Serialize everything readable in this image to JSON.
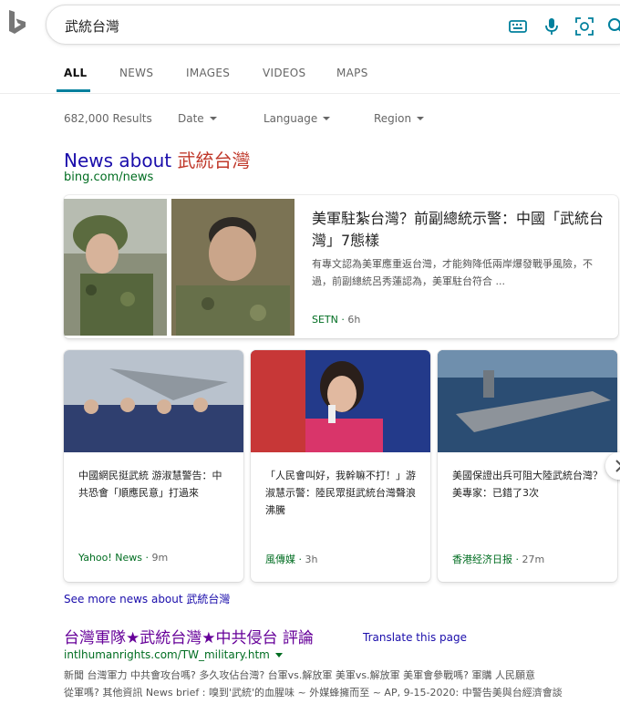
{
  "search": {
    "query": "武統台灣",
    "icons": [
      "keyboard-icon",
      "microphone-icon",
      "visual-search-icon",
      "search-icon"
    ]
  },
  "tabs": [
    "ALL",
    "NEWS",
    "IMAGES",
    "VIDEOS",
    "MAPS"
  ],
  "active_tab": "ALL",
  "filters": {
    "results_count": "682,000 Results",
    "date": "Date",
    "language": "Language",
    "region": "Region"
  },
  "news_section": {
    "title_prefix": "News about ",
    "title_query": "武統台灣",
    "source_url": "bing.com/news",
    "main": {
      "title": "美軍駐紮台灣？前副總統示警：中國「武統台灣」7態樣",
      "snippet": "有專文認為美軍應重返台灣，才能夠降低兩岸爆發戰爭風險，不過，前副總統呂秀蓮認為，美軍駐台符合 ...",
      "source": "SETN",
      "time": "6h"
    },
    "cards": [
      {
        "title": "中國網民挺武統 游淑慧警告：中共恐會「順應民意」打過來",
        "source": "Yahoo! News",
        "time": "9m"
      },
      {
        "title": "「人民會叫好，我幹嘛不打！」游淑慧示警：陸民眾挺武統台灣聲浪沸騰",
        "source": "風傳媒",
        "time": "3h"
      },
      {
        "title": "美國保證出兵可阻大陸武統台灣？美專家：已錯了3次",
        "source": "香港经济日报",
        "time": "27m"
      }
    ],
    "see_more": "See more news about 武統台灣"
  },
  "result": {
    "title": "台灣軍隊★武統台灣★中共侵台 評論",
    "translate": "Translate this page",
    "url": "intlhumanrights.com/TW_military.htm",
    "snippet_line1": "新聞 台灣軍力 中共會攻台嗎? 多久攻佔台灣? 台軍vs.解放軍 美軍vs.解放軍 美軍會參戰嗎? 軍購 人民願意",
    "snippet_line2": "從軍嗎? 其他資訊 News brief : 嗅到'武統'的血腥味 ~ 外媒蜂擁而至 ~ AP, 9-15-2020: 中警告美與台經濟會談"
  },
  "colors": {
    "link": "#1a0dab",
    "visited": "#660099",
    "url_green": "#006d21",
    "accent": "#00809d",
    "query_highlight": "#c0392b"
  }
}
